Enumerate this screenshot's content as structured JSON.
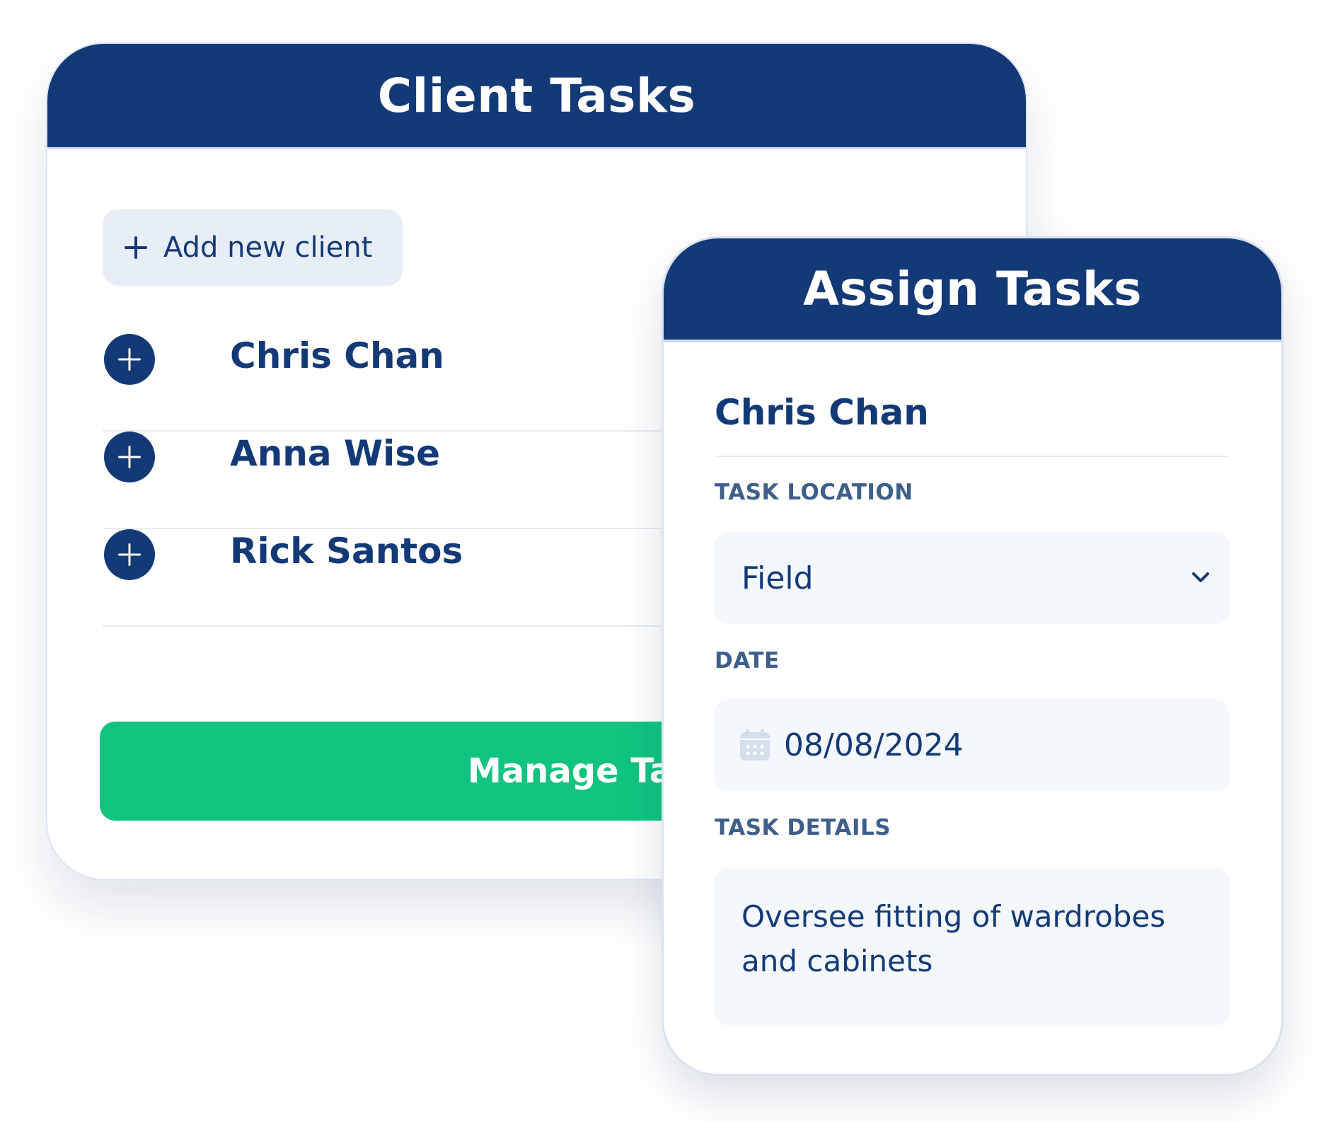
{
  "client_tasks": {
    "title": "Client Tasks",
    "add_client_label": "Add new client",
    "clients": [
      {
        "name": "Chris Chan"
      },
      {
        "name": "Anna Wise"
      },
      {
        "name": "Rick Santos"
      }
    ],
    "manage_label": "Manage Tasks"
  },
  "assign_tasks": {
    "title": "Assign Tasks",
    "selected_client": "Chris Chan",
    "location_label": "TASK LOCATION",
    "location_value": "Field",
    "date_label": "DATE",
    "date_value": "08/08/2024",
    "details_label": "TASK DETAILS",
    "details_value": "Oversee fitting of wardrobes and cabinets"
  },
  "colors": {
    "navy": "#133a76",
    "green": "#10c47f",
    "field_bg": "#f4f7fc",
    "label": "#3d5f8a"
  },
  "icons": {
    "add": "plus-icon",
    "client_row": "plus-circle-icon",
    "dropdown": "chevron-down-icon",
    "date": "calendar-icon"
  }
}
